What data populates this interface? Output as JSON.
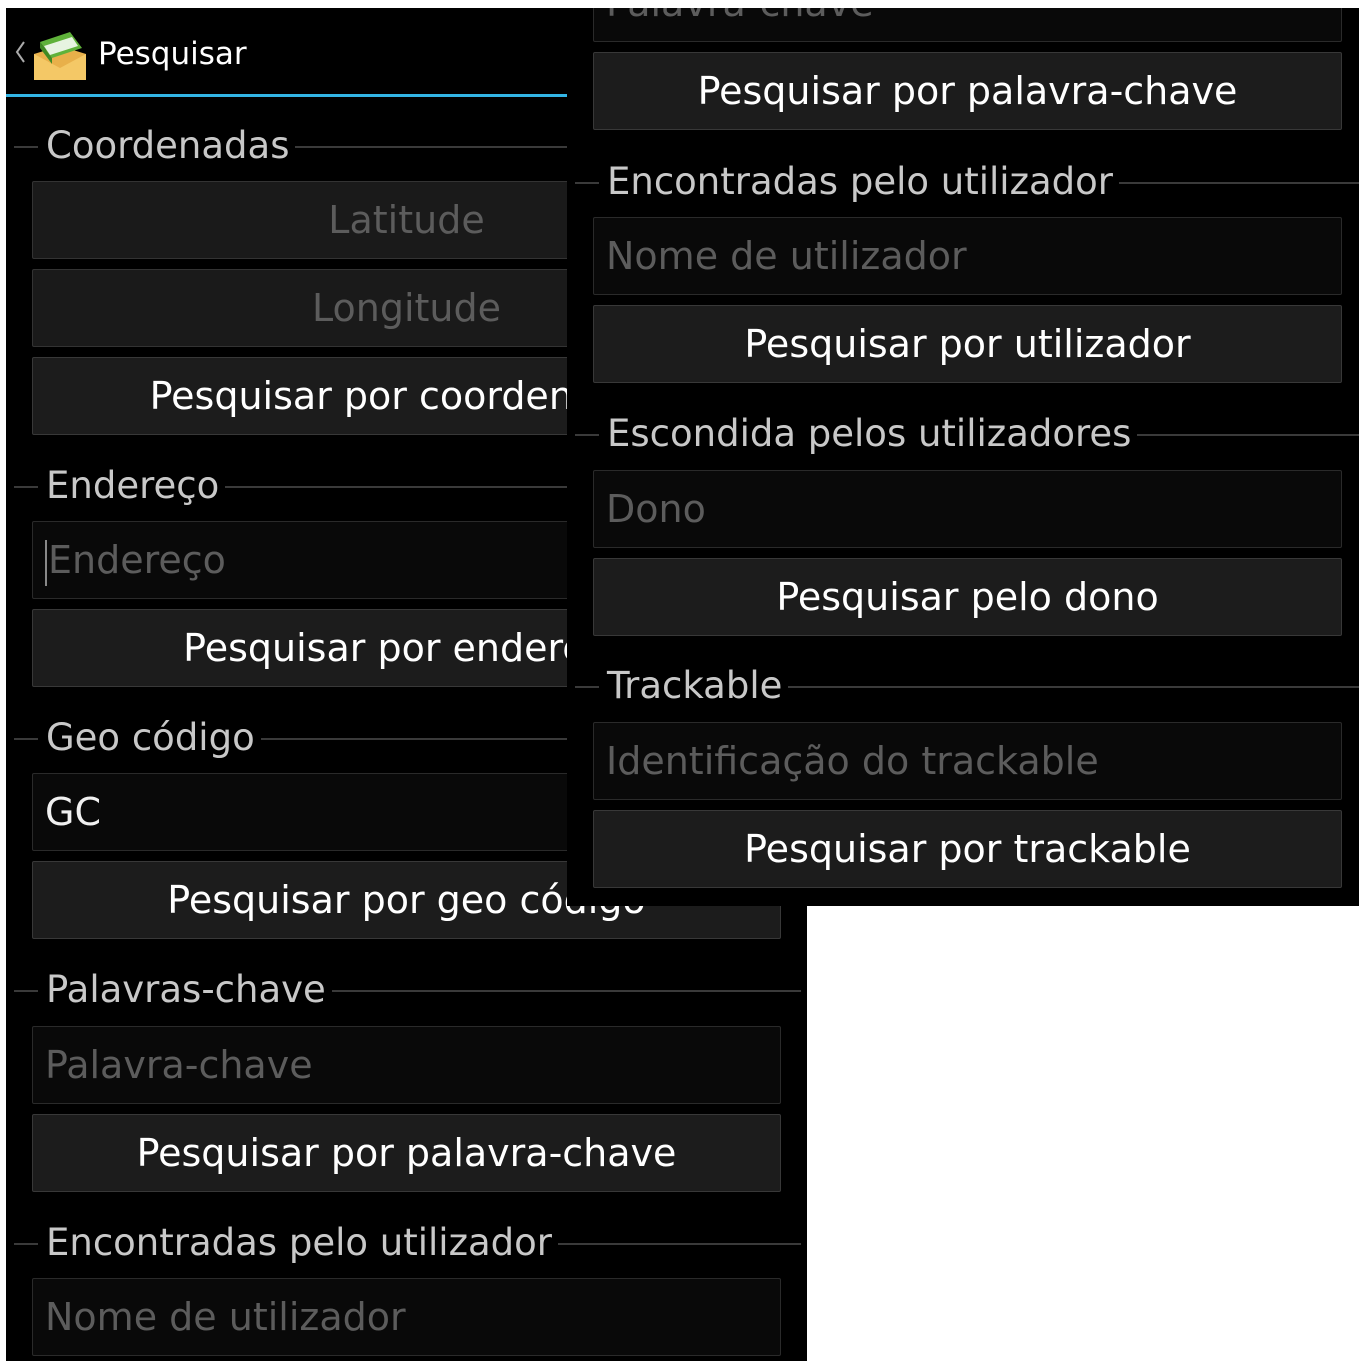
{
  "app": {
    "title": "Pesquisar",
    "accent_color": "#33b5e5",
    "icon": "geocaching-app-icon"
  },
  "sections": {
    "coordinates": {
      "label": "Coordenadas",
      "latitude_placeholder": "Latitude",
      "longitude_placeholder": "Longitude",
      "button": "Pesquisar por coordenadas"
    },
    "address": {
      "label": "Endereço",
      "placeholder": "Endereço",
      "button": "Pesquisar por endereço"
    },
    "geocode": {
      "label": "Geo código",
      "value": "GC",
      "button": "Pesquisar por geo código"
    },
    "keywords": {
      "label": "Palavras-chave",
      "placeholder": "Palavra-chave",
      "button": "Pesquisar por palavra-chave"
    },
    "found_by_user": {
      "label": "Encontradas pelo utilizador",
      "placeholder": "Nome de utilizador",
      "button": "Pesquisar por utilizador"
    },
    "hidden_by_user": {
      "label": "Escondida pelos utilizadores",
      "placeholder": "Dono",
      "button": "Pesquisar pelo dono"
    },
    "trackable": {
      "label": "Trackable",
      "placeholder": "Identificação do trackable",
      "button": "Pesquisar por trackable"
    }
  }
}
